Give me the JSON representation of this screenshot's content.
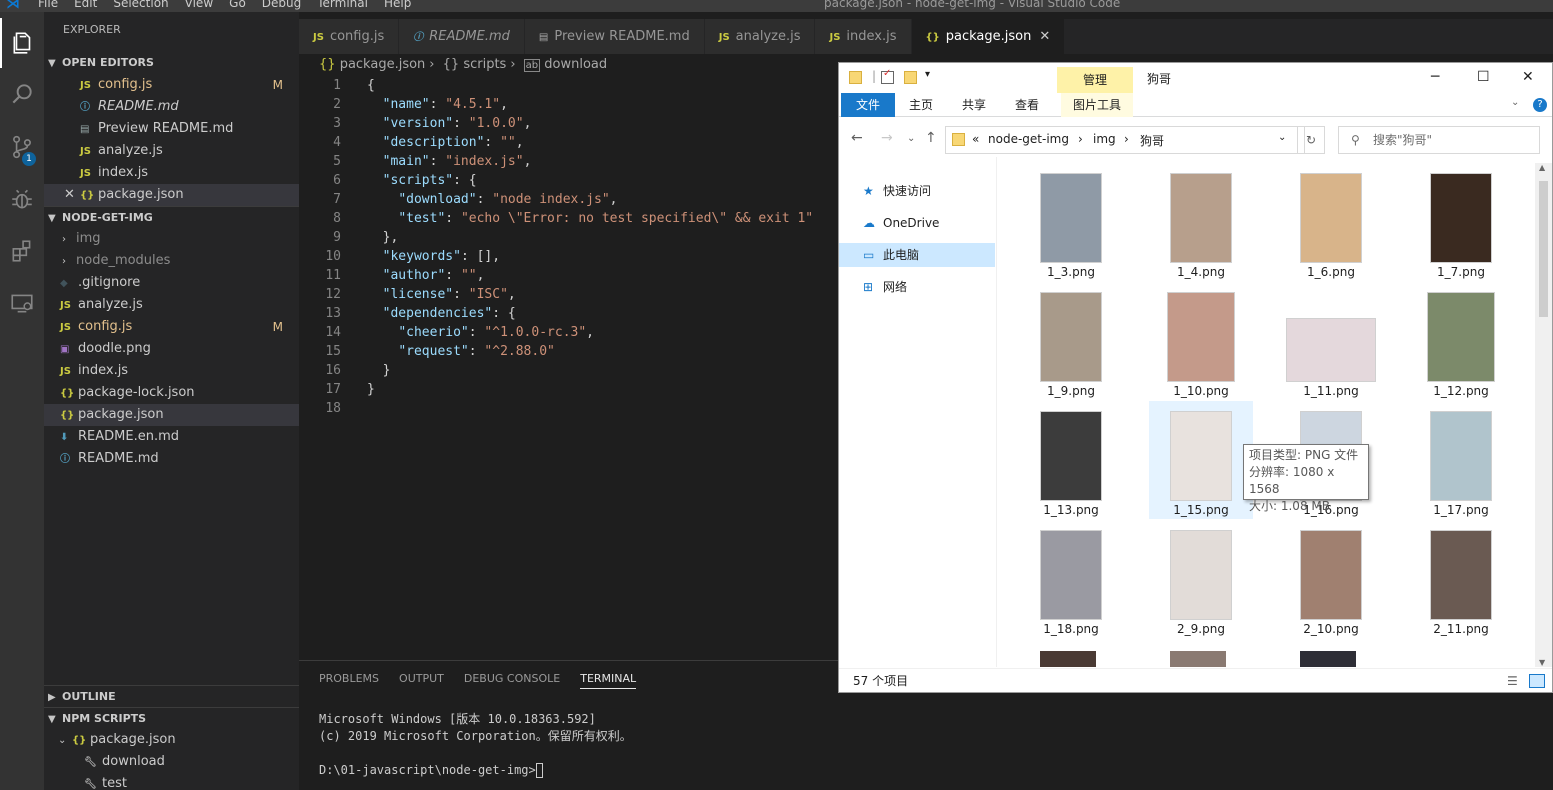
{
  "window": {
    "title": "package.json - node-get-img - Visual Studio Code",
    "menu": [
      "File",
      "Edit",
      "Selection",
      "View",
      "Go",
      "Debug",
      "Terminal",
      "Help"
    ]
  },
  "activity": {
    "scm_badge": "1"
  },
  "sidebar": {
    "title": "EXPLORER",
    "open_editors": {
      "header": "OPEN EDITORS",
      "items": [
        {
          "label": "config.js",
          "icon": "JS",
          "status": "M"
        },
        {
          "label": "README.md",
          "icon": "info-icon"
        },
        {
          "label": "Preview README.md",
          "icon": "preview-icon"
        },
        {
          "label": "analyze.js",
          "icon": "JS"
        },
        {
          "label": "index.js",
          "icon": "JS"
        },
        {
          "label": "package.json",
          "icon": "{}",
          "close": "✕"
        }
      ]
    },
    "folder": {
      "header": "NODE-GET-IMG",
      "items": [
        {
          "label": "img",
          "type": "folder"
        },
        {
          "label": "node_modules",
          "type": "folder"
        },
        {
          "label": ".gitignore",
          "icon": "◆"
        },
        {
          "label": "analyze.js",
          "icon": "JS"
        },
        {
          "label": "config.js",
          "icon": "JS",
          "status": "M"
        },
        {
          "label": "doodle.png",
          "icon": "image-icon"
        },
        {
          "label": "index.js",
          "icon": "JS"
        },
        {
          "label": "package-lock.json",
          "icon": "{}"
        },
        {
          "label": "package.json",
          "icon": "{}"
        },
        {
          "label": "README.en.md",
          "icon": "⬇"
        },
        {
          "label": "README.md",
          "icon": "info-icon"
        }
      ]
    },
    "outline": {
      "header": "OUTLINE"
    },
    "npm_scripts": {
      "header": "NPM SCRIPTS",
      "package": "package.json",
      "scripts": [
        "download",
        "test"
      ]
    }
  },
  "tabs": [
    {
      "label": "config.js",
      "icon": "JS"
    },
    {
      "label": "README.md",
      "icon": "ⓘ"
    },
    {
      "label": "Preview README.md",
      "icon": "▤"
    },
    {
      "label": "analyze.js",
      "icon": "JS"
    },
    {
      "label": "index.js",
      "icon": "JS"
    },
    {
      "label": "package.json",
      "icon": "{}",
      "close": "✕",
      "active": true
    }
  ],
  "breadcrumb": [
    "package.json",
    "scripts",
    "download"
  ],
  "editor": {
    "lines": [
      "{",
      "  \"name\": \"4.5.1\",",
      "  \"version\": \"1.0.0\",",
      "  \"description\": \"\",",
      "  \"main\": \"index.js\",",
      "  \"scripts\": {",
      "    \"download\": \"node index.js\",",
      "    \"test\": \"echo \\\"Error: no test specified\\\" && exit 1\"",
      "  },",
      "  \"keywords\": [],",
      "  \"author\": \"\",",
      "  \"license\": \"ISC\",",
      "  \"dependencies\": {",
      "    \"cheerio\": \"^1.0.0-rc.3\",",
      "    \"request\": \"^2.88.0\"",
      "  }",
      "}",
      ""
    ]
  },
  "panel": {
    "tabs": [
      "PROBLEMS",
      "OUTPUT",
      "DEBUG CONSOLE",
      "TERMINAL"
    ],
    "terminal": [
      "Microsoft Windows [版本 10.0.18363.592]",
      "(c) 2019 Microsoft Corporation。保留所有权利。",
      "",
      "D:\\01-javascript\\node-get-img>"
    ]
  },
  "file_explorer": {
    "context_tab": "管理",
    "title": "狗哥",
    "ribbon": [
      "文件",
      "主页",
      "共享",
      "查看",
      "图片工具"
    ],
    "path": [
      "«",
      "node-get-img",
      "img",
      "狗哥"
    ],
    "search_placeholder": "搜索\"狗哥\"",
    "nav": [
      "快速访问",
      "OneDrive",
      "此电脑",
      "网络"
    ],
    "files": [
      "1_3.png",
      "1_4.png",
      "1_6.png",
      "1_7.png",
      "1_9.png",
      "1_10.png",
      "1_11.png",
      "1_12.png",
      "1_13.png",
      "1_15.png",
      "1_16.png",
      "1_17.png",
      "1_18.png",
      "2_9.png",
      "2_10.png",
      "2_11.png"
    ],
    "tooltip": [
      "项目类型: PNG 文件",
      "分辨率: 1080 x 1568",
      "大小: 1.08 MB"
    ],
    "status": "57 个项目"
  }
}
